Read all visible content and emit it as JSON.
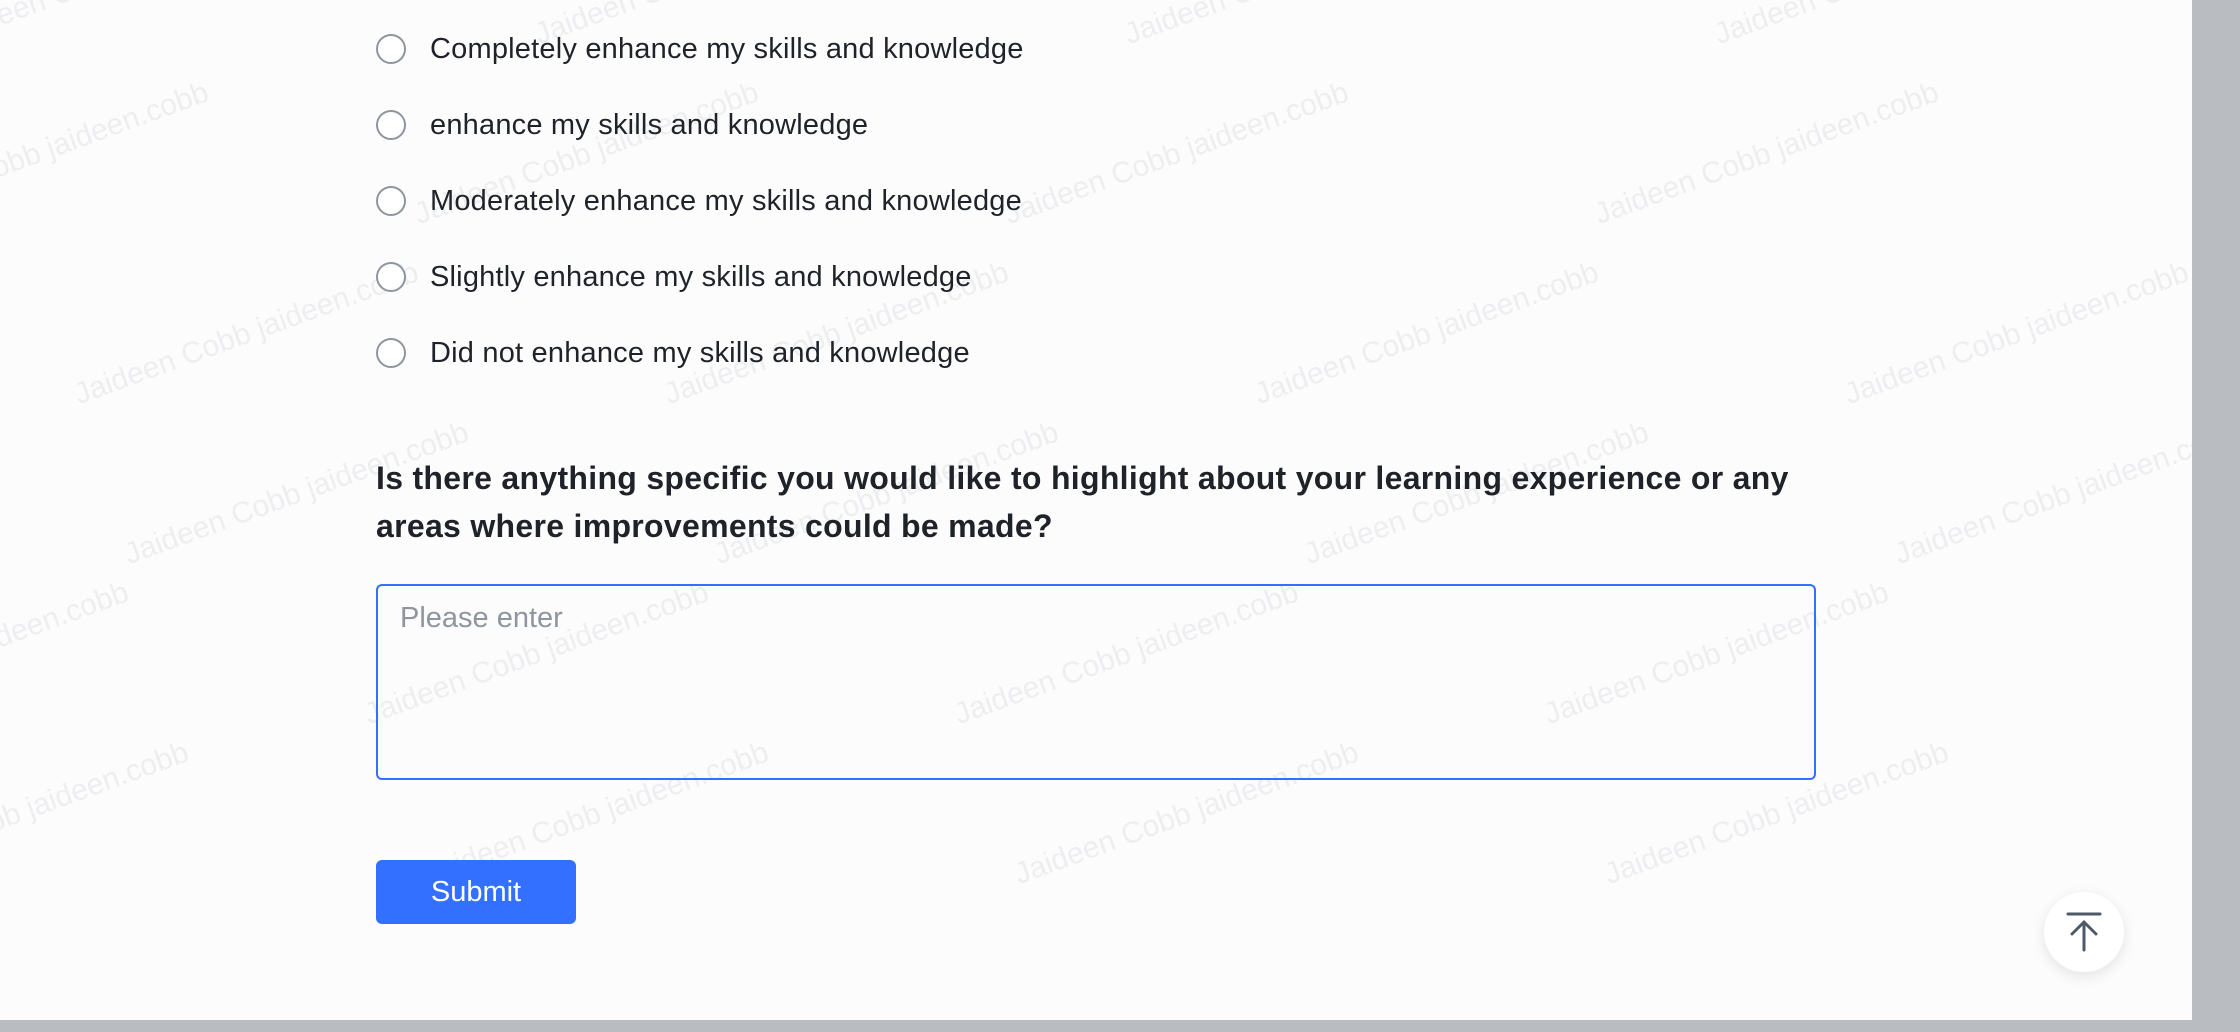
{
  "watermark": {
    "text": "Jaideen Cobb jaideen.cobb"
  },
  "options": [
    {
      "label": "Completely enhance my skills and knowledge"
    },
    {
      "label": "enhance my skills and knowledge"
    },
    {
      "label": "Moderately enhance my skills and knowledge"
    },
    {
      "label": "Slightly enhance my skills and knowledge"
    },
    {
      "label": "Did not enhance my skills and knowledge"
    }
  ],
  "question": {
    "line1": "Is there anything specific you would like to highlight about your learning experience or any",
    "line2": "areas where improvements could be made?"
  },
  "feedback_input": {
    "placeholder": "Please enter",
    "value": ""
  },
  "submit_label": "Submit",
  "back_to_top_icon": "arrow-up-to-line-icon",
  "colors": {
    "accent": "#3370ff",
    "text": "#1f2329",
    "placeholder": "#8f959e",
    "scrollbar": "#b9bcc1"
  }
}
